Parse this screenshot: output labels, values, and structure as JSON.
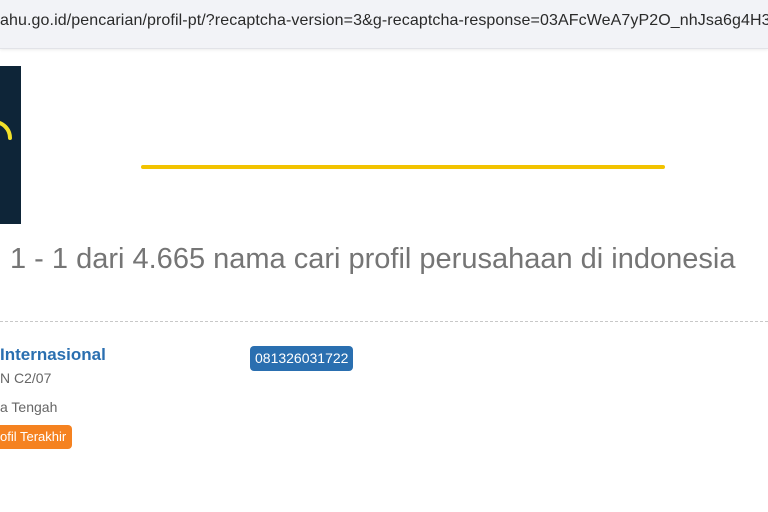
{
  "browser": {
    "url": "ahu.go.id/pencarian/profil-pt/?recaptcha-version=3&g-recaptcha-response=03AFcWeA7yP2O_nhJsa6g4H31"
  },
  "header": {
    "accent_color": "#f2c300",
    "banner_color": "#0e2538"
  },
  "results": {
    "summary": "1 - 1 dari 4.665 nama cari profil perusahaan di indonesia"
  },
  "company": {
    "name": "Internasional",
    "address_line1": "N C2/07",
    "address_line2": "a Tengah",
    "badge": "ofil Terakhir",
    "phone": "081326031722"
  },
  "colors": {
    "name": "#2a6fb0",
    "badge": "#f58220",
    "phone": "#2a6fb0"
  }
}
